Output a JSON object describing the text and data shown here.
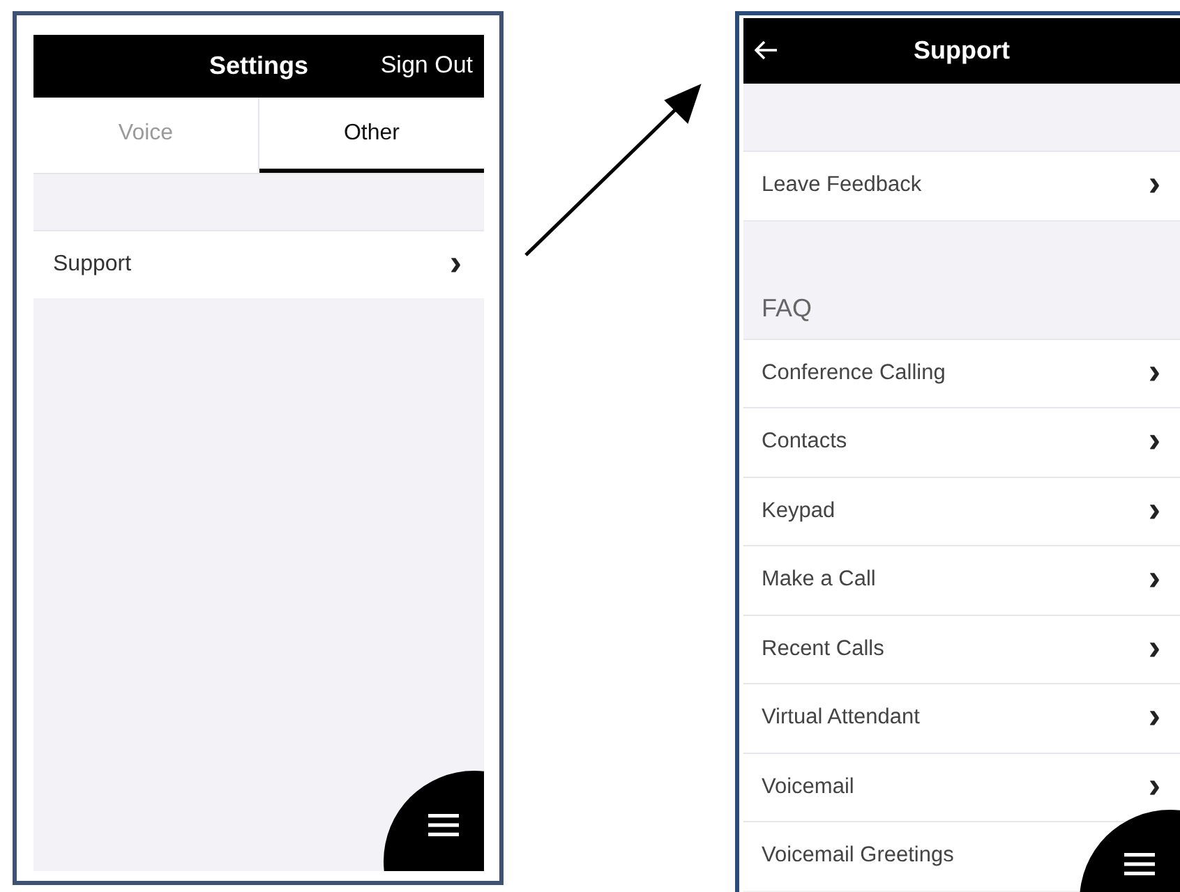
{
  "settings_screen": {
    "header": {
      "title": "Settings",
      "action": "Sign Out"
    },
    "tabs": [
      {
        "label": "Voice",
        "selected": false
      },
      {
        "label": "Other",
        "selected": true
      }
    ],
    "rows": [
      {
        "label": "Support",
        "chevron": "›"
      }
    ]
  },
  "support_screen": {
    "header": {
      "title": "Support",
      "back": true
    },
    "sections": [
      {
        "rows": [
          {
            "label": "Leave Feedback",
            "chevron": "›"
          }
        ]
      },
      {
        "heading": "FAQ",
        "rows": [
          {
            "label": "Conference Calling",
            "chevron": "›"
          },
          {
            "label": "Contacts",
            "chevron": "›"
          },
          {
            "label": "Keypad",
            "chevron": "›"
          },
          {
            "label": "Make a Call",
            "chevron": "›"
          },
          {
            "label": "Recent Calls",
            "chevron": "›"
          },
          {
            "label": "Virtual Attendant",
            "chevron": "›"
          },
          {
            "label": "Voicemail",
            "chevron": "›"
          },
          {
            "label": "Voicemail Greetings"
          }
        ]
      }
    ]
  }
}
